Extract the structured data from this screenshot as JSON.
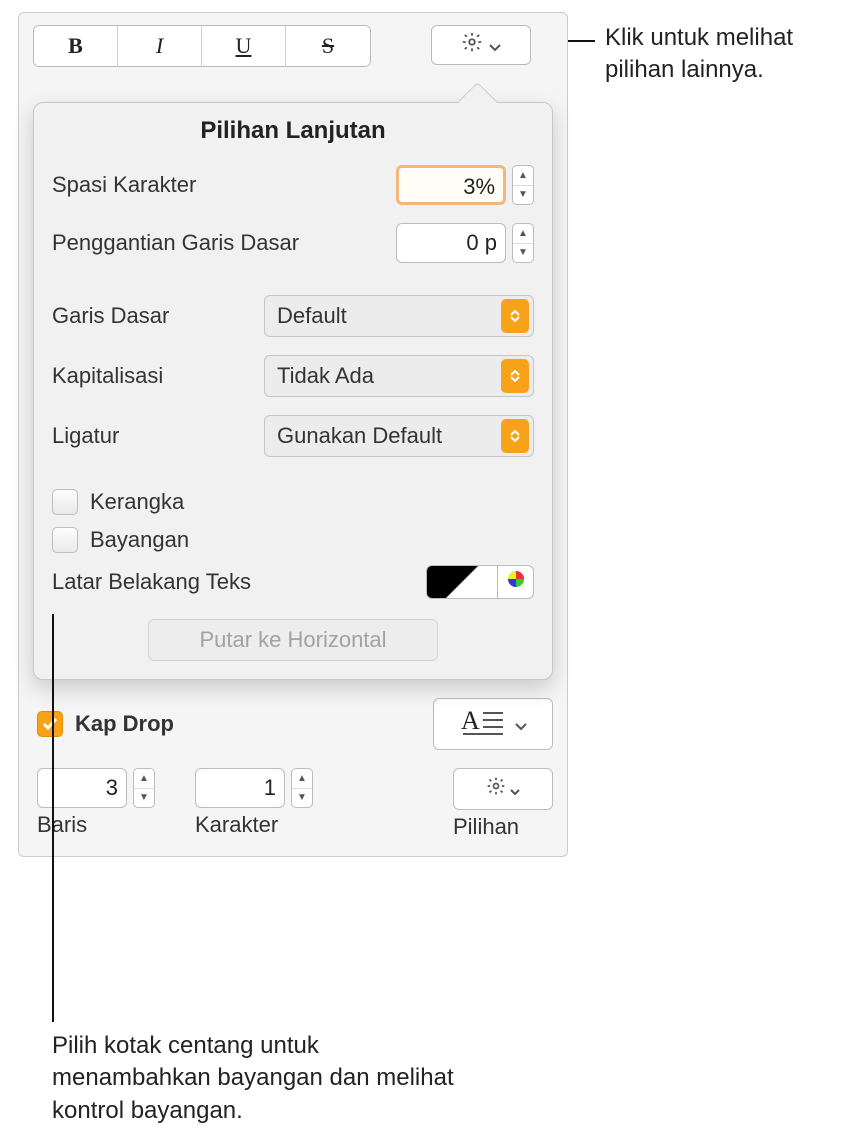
{
  "toolbar": {
    "bold": "B",
    "italic": "I",
    "underline": "U",
    "strike": "S"
  },
  "popover": {
    "title": "Pilihan Lanjutan",
    "character_spacing_label": "Spasi Karakter",
    "character_spacing_value": "3%",
    "baseline_shift_label": "Penggantian Garis Dasar",
    "baseline_shift_value": "0 p",
    "baseline_label": "Garis Dasar",
    "baseline_value": "Default",
    "capitalization_label": "Kapitalisasi",
    "capitalization_value": "Tidak Ada",
    "ligature_label": "Ligatur",
    "ligature_value": "Gunakan Default",
    "outline_label": "Kerangka",
    "shadow_label": "Bayangan",
    "text_background_label": "Latar Belakang Teks",
    "rotate_label": "Putar ke Horizontal"
  },
  "dropcap": {
    "label": "Kap Drop",
    "lines_value": "3",
    "lines_label": "Baris",
    "chars_value": "1",
    "chars_label": "Karakter",
    "options_label": "Pilihan"
  },
  "callouts": {
    "top": "Klik untuk melihat pilihan lainnya.",
    "bottom": "Pilih kotak centang untuk menambahkan bayangan dan melihat kontrol bayangan."
  }
}
